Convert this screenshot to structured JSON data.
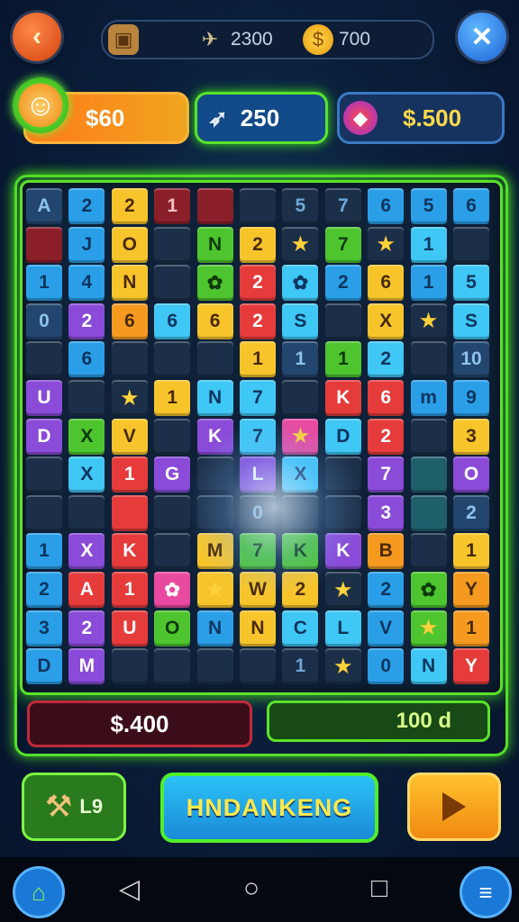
{
  "top_bar": {
    "left_icon": "crate-icon",
    "item1": {
      "icon": "propeller-icon",
      "value": "2300"
    },
    "item2": {
      "icon": "gold-coin-icon",
      "value": "700"
    }
  },
  "stats": {
    "player": {
      "icon": "character-avatar-icon",
      "value": "$60"
    },
    "middle": {
      "icon": "rocket-icon",
      "value": "250"
    },
    "right": {
      "icon": "gem-icon",
      "value": "$.500"
    }
  },
  "board": {
    "cols": 11,
    "rows": 13,
    "cells": [
      [
        "A",
        "navy"
      ],
      [
        "2",
        "blue"
      ],
      [
        "2",
        "yellow"
      ],
      [
        "1",
        "maroon"
      ],
      [
        "",
        "maroon"
      ],
      [
        "",
        "dark"
      ],
      [
        "5",
        "dark"
      ],
      [
        "7",
        "dark"
      ],
      [
        "6",
        "blue"
      ],
      [
        "5",
        "blue"
      ],
      [
        "6",
        "blue"
      ],
      [
        "",
        "maroon"
      ],
      [
        "J",
        "blue"
      ],
      [
        "O",
        "yellow"
      ],
      [
        "",
        "dark"
      ],
      [
        "N",
        "green"
      ],
      [
        "2",
        "yellow"
      ],
      [
        "★",
        "dark"
      ],
      [
        "7",
        "green"
      ],
      [
        "★",
        "dark"
      ],
      [
        "1",
        "cyan"
      ],
      [
        "",
        "dark"
      ],
      [
        "1",
        "blue"
      ],
      [
        "4",
        "blue"
      ],
      [
        "N",
        "yellow"
      ],
      [
        "",
        "dark"
      ],
      [
        "✿",
        "green"
      ],
      [
        "2",
        "red"
      ],
      [
        "✿",
        "cyan"
      ],
      [
        "2",
        "blue"
      ],
      [
        "6",
        "yellow"
      ],
      [
        "1",
        "blue"
      ],
      [
        "5",
        "cyan"
      ],
      [
        "0",
        "navy"
      ],
      [
        "2",
        "purple"
      ],
      [
        "6",
        "orange"
      ],
      [
        "6",
        "cyan"
      ],
      [
        "6",
        "yellow"
      ],
      [
        "2",
        "red"
      ],
      [
        "S",
        "cyan"
      ],
      [
        "",
        "dark"
      ],
      [
        "X",
        "yellow"
      ],
      [
        "★",
        "dark"
      ],
      [
        "S",
        "cyan"
      ],
      [
        "",
        "dark"
      ],
      [
        "6",
        "blue"
      ],
      [
        "",
        "dark"
      ],
      [
        "",
        "dark"
      ],
      [
        "",
        "dark"
      ],
      [
        "1",
        "yellow"
      ],
      [
        "1",
        "navy"
      ],
      [
        "1",
        "green"
      ],
      [
        "2",
        "cyan"
      ],
      [
        "",
        "dark"
      ],
      [
        "10",
        "navy"
      ],
      [
        "U",
        "purple"
      ],
      [
        "",
        "dark"
      ],
      [
        "★",
        "dark"
      ],
      [
        "1",
        "yellow"
      ],
      [
        "N",
        "cyan"
      ],
      [
        "7",
        "cyan"
      ],
      [
        "",
        "dark"
      ],
      [
        "K",
        "red"
      ],
      [
        "6",
        "red"
      ],
      [
        "m",
        "blue"
      ],
      [
        "9",
        "blue"
      ],
      [
        "D",
        "purple"
      ],
      [
        "X",
        "green"
      ],
      [
        "V",
        "yellow"
      ],
      [
        "",
        "dark"
      ],
      [
        "K",
        "purple"
      ],
      [
        "7",
        "cyan"
      ],
      [
        "★",
        "pink"
      ],
      [
        "D",
        "cyan"
      ],
      [
        "2",
        "red"
      ],
      [
        "",
        "dark"
      ],
      [
        "3",
        "yellow"
      ],
      [
        "",
        "dark"
      ],
      [
        "X",
        "cyan"
      ],
      [
        "1",
        "red"
      ],
      [
        "G",
        "purple"
      ],
      [
        "",
        "dark"
      ],
      [
        "L",
        "purple"
      ],
      [
        "X",
        "cyan"
      ],
      [
        "",
        "dark"
      ],
      [
        "7",
        "purple"
      ],
      [
        "",
        "teal"
      ],
      [
        "O",
        "purple"
      ],
      [
        "",
        "dark"
      ],
      [
        "",
        "dark"
      ],
      [
        "",
        "red"
      ],
      [
        "",
        "dark"
      ],
      [
        "",
        "dark"
      ],
      [
        "0",
        "dark"
      ],
      [
        "",
        "dark"
      ],
      [
        "",
        "dark"
      ],
      [
        "3",
        "purple"
      ],
      [
        "",
        "teal"
      ],
      [
        "2",
        "navy"
      ],
      [
        "1",
        "blue"
      ],
      [
        "X",
        "purple"
      ],
      [
        "K",
        "red"
      ],
      [
        "",
        "dark"
      ],
      [
        "M",
        "yellow"
      ],
      [
        "7",
        "green"
      ],
      [
        "K",
        "green"
      ],
      [
        "K",
        "purple"
      ],
      [
        "B",
        "orange"
      ],
      [
        "",
        "dark"
      ],
      [
        "1",
        "yellow"
      ],
      [
        "2",
        "blue"
      ],
      [
        "A",
        "red"
      ],
      [
        "1",
        "red"
      ],
      [
        "✿",
        "pink"
      ],
      [
        "★",
        "yellow"
      ],
      [
        "W",
        "yellow"
      ],
      [
        "2",
        "yellow"
      ],
      [
        "★",
        "dark"
      ],
      [
        "2",
        "blue"
      ],
      [
        "✿",
        "green"
      ],
      [
        "Y",
        "orange"
      ],
      [
        "3",
        "blue"
      ],
      [
        "2",
        "purple"
      ],
      [
        "U",
        "red"
      ],
      [
        "O",
        "green"
      ],
      [
        "N",
        "blue"
      ],
      [
        "N",
        "yellow"
      ],
      [
        "C",
        "cyan"
      ],
      [
        "L",
        "cyan"
      ],
      [
        "V",
        "blue"
      ],
      [
        "★",
        "green"
      ],
      [
        "1",
        "orange"
      ],
      [
        "D",
        "blue"
      ],
      [
        "M",
        "purple"
      ],
      [
        "",
        "dark"
      ],
      [
        "",
        "dark"
      ],
      [
        "",
        "dark"
      ],
      [
        "",
        "dark"
      ],
      [
        "1",
        "dark"
      ],
      [
        "★",
        "dark"
      ],
      [
        "0",
        "blue"
      ],
      [
        "N",
        "cyan"
      ],
      [
        "Y",
        "red"
      ]
    ]
  },
  "bottom_stats": {
    "left": "$.400",
    "right": "100 d"
  },
  "actions": {
    "tool_label": "L9",
    "main_label": "HNDANKENG",
    "play_icon": "play-icon"
  },
  "colors": {
    "accent_green": "#5be22b",
    "board_bg": "#0e2138"
  }
}
